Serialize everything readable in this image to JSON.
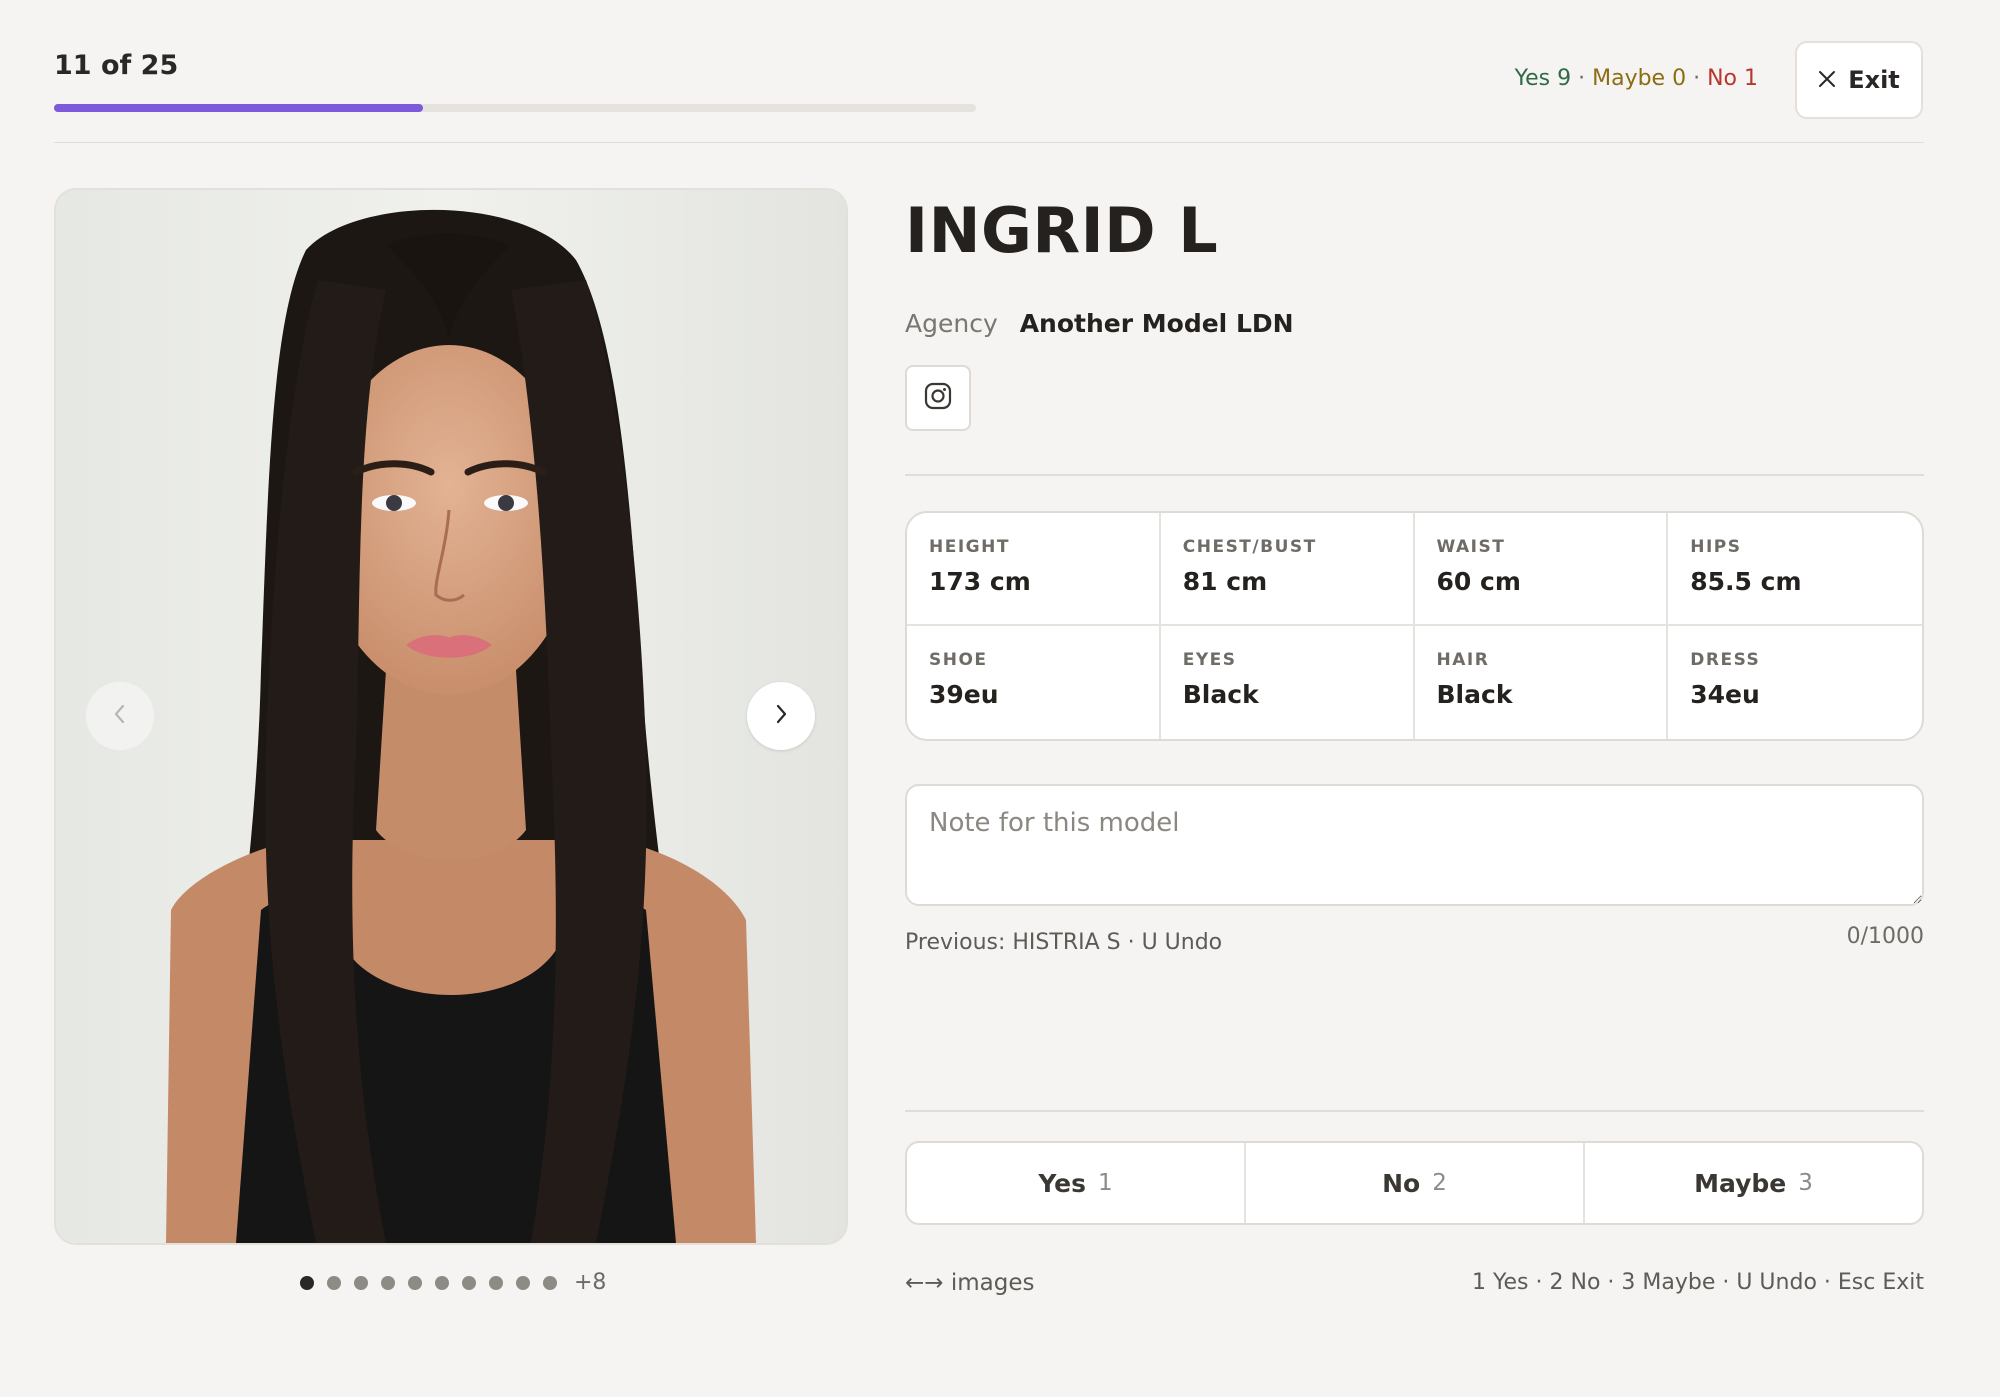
{
  "header": {
    "counter": "11 of 25",
    "progress_fraction": 0.4,
    "tally": {
      "yes": "Yes 9",
      "maybe": "Maybe 0",
      "no": "No 1",
      "separator": " · "
    },
    "exit_label": "Exit"
  },
  "gallery": {
    "prev_icon": "chevron-left-icon",
    "next_icon": "chevron-right-icon",
    "dot_count": 10,
    "active_dot": 0,
    "more_label": "+8"
  },
  "model": {
    "name": "INGRID L",
    "agency_label": "Agency",
    "agency_name": "Another Model LDN",
    "social_icon": "instagram-icon"
  },
  "stats": [
    {
      "label": "HEIGHT",
      "value": "173 cm"
    },
    {
      "label": "CHEST/BUST",
      "value": "81 cm"
    },
    {
      "label": "WAIST",
      "value": "60 cm"
    },
    {
      "label": "HIPS",
      "value": "85.5 cm"
    },
    {
      "label": "SHOE",
      "value": "39eu"
    },
    {
      "label": "EYES",
      "value": "Black"
    },
    {
      "label": "HAIR",
      "value": "Black"
    },
    {
      "label": "DRESS",
      "value": "34eu"
    }
  ],
  "note": {
    "placeholder": "Note for this model",
    "value": "",
    "char_count": "0/1000"
  },
  "previous": "Previous: HISTRIA S · U Undo",
  "decisions": [
    {
      "label": "Yes",
      "key": "1"
    },
    {
      "label": "No",
      "key": "2"
    },
    {
      "label": "Maybe",
      "key": "3"
    }
  ],
  "footer": {
    "images_hint": "←→ images",
    "shortcuts": "1 Yes · 2 No · 3 Maybe · U Undo · Esc Exit"
  },
  "colors": {
    "accent": "#7c5ad9",
    "yes": "#2f6b46",
    "maybe": "#8b6d12",
    "no": "#b8372d",
    "background": "#f5f4f2"
  }
}
